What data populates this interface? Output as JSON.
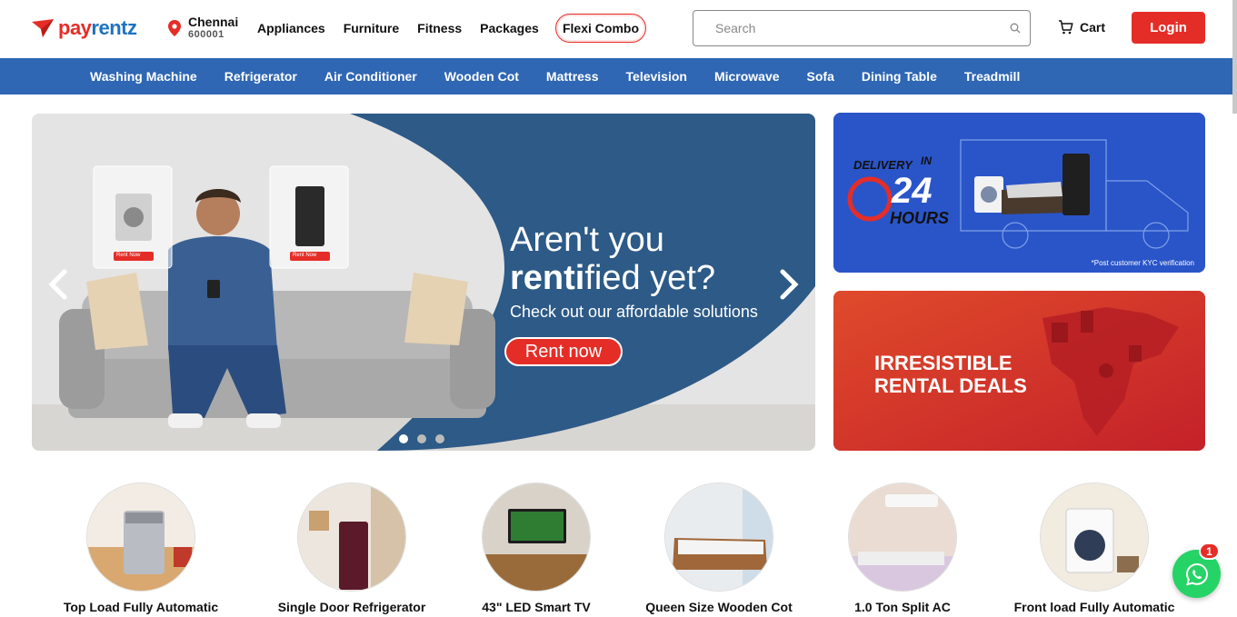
{
  "brand": {
    "name_part1": "pay",
    "name_part2": "rentz",
    "accent": "#e52d27",
    "blue": "#1e73be"
  },
  "location": {
    "city": "Chennai",
    "pincode": "600001"
  },
  "topnav": [
    "Appliances",
    "Furniture",
    "Fitness",
    "Packages"
  ],
  "flexi_label": "Flexi Combo",
  "search": {
    "placeholder": "Search",
    "value": ""
  },
  "cart_label": "Cart",
  "login_label": "Login",
  "categories_bar": [
    "Washing Machine",
    "Refrigerator",
    "Air Conditioner",
    "Wooden Cot",
    "Mattress",
    "Television",
    "Microwave",
    "Sofa",
    "Dining Table",
    "Treadmill"
  ],
  "hero": {
    "line1": "Aren't you",
    "line2_bold": "renti",
    "line2_rest": "fied yet?",
    "sub": "Check out our affordable solutions",
    "cta": "Rent now",
    "card_label": "Rent Now",
    "slides": 3,
    "active_slide": 1
  },
  "side_banner_1": {
    "delivery_word": "DELIVERY",
    "in_word": "IN",
    "hours_num": "24",
    "hours_word": "HOURS",
    "note": "*Post customer KYC verification"
  },
  "side_banner_2": {
    "line1": "IRRESISTIBLE",
    "line2": "RENTAL DEALS"
  },
  "product_categories": [
    {
      "label": "Top Load Fully Automatic",
      "icon": "top-load-washer"
    },
    {
      "label": "Single Door Refrigerator",
      "icon": "single-door-fridge"
    },
    {
      "label": "43\" LED Smart TV",
      "icon": "smart-tv"
    },
    {
      "label": "Queen Size Wooden Cot",
      "icon": "wooden-cot"
    },
    {
      "label": "1.0 Ton Split AC",
      "icon": "split-ac"
    },
    {
      "label": "Front load Fully Automatic",
      "icon": "front-load-washer"
    }
  ],
  "whatsapp": {
    "badge": "1",
    "color": "#25d366"
  }
}
